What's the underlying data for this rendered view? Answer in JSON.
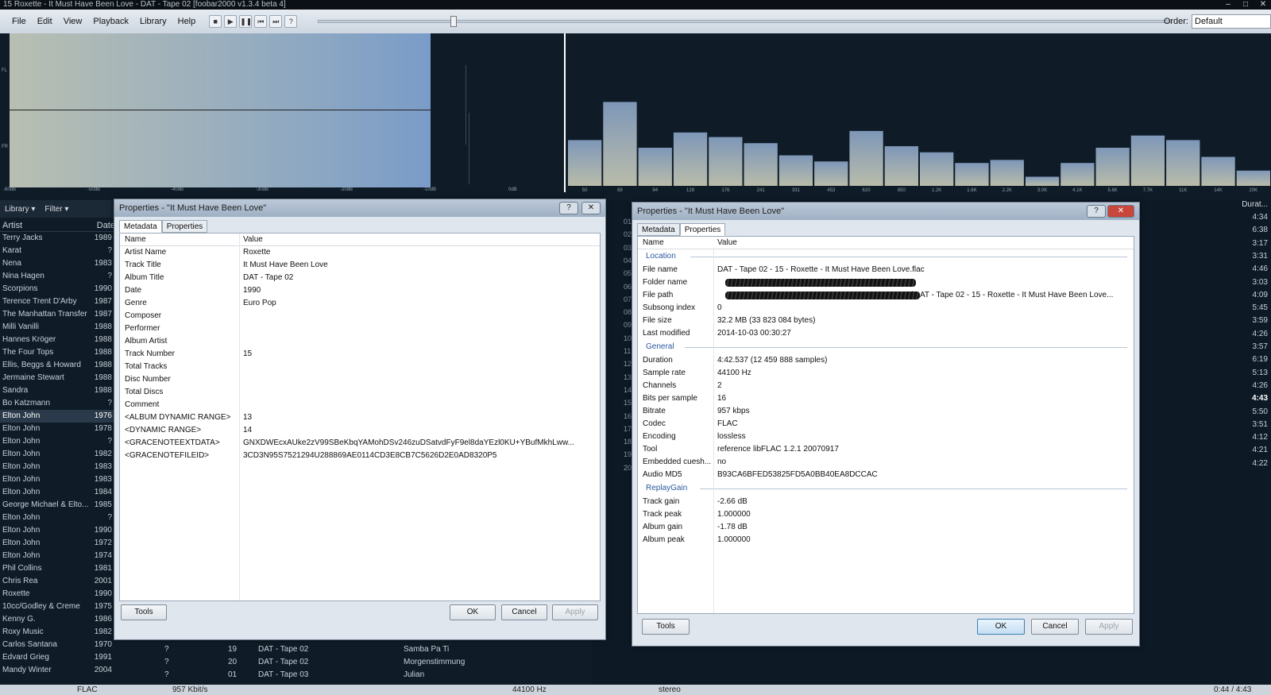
{
  "window": {
    "title": "15 Roxette - It Must Have Been Love - DAT - Tape 02   [foobar2000 v1.3.4 beta 4]"
  },
  "menu": [
    "File",
    "Edit",
    "View",
    "Playback",
    "Library",
    "Help"
  ],
  "order": {
    "label": "Order:",
    "value": "Default"
  },
  "visualizer": {
    "spectrogram_db_labels": [
      "-60dB",
      "-50dB",
      "-40dB",
      "-30dB",
      "-20dB",
      "-10dB",
      "0dB"
    ],
    "channel_labels": [
      "FL",
      "FR"
    ],
    "spectrum_freq_labels": [
      "50",
      "69",
      "94",
      "128",
      "176",
      "241",
      "331",
      "453",
      "620",
      "850",
      "1.2K",
      "1.6K",
      "2.2K",
      "3.0K",
      "4.1K",
      "5.6K",
      "7.7K",
      "11K",
      "14K",
      "20K"
    ],
    "spectrum_levels": [
      0.3,
      0.55,
      0.25,
      0.35,
      0.32,
      0.28,
      0.2,
      0.16,
      0.36,
      0.26,
      0.22,
      0.15,
      0.17,
      0.06,
      0.15,
      0.25,
      0.33,
      0.3,
      0.19,
      0.1
    ]
  },
  "library": {
    "buttons": [
      "Library",
      "Filter"
    ],
    "col_artist": "Artist",
    "col_date": "Date",
    "rows": [
      {
        "artist": "Terry Jacks",
        "date": "1989"
      },
      {
        "artist": "Karat",
        "date": "?"
      },
      {
        "artist": "Nena",
        "date": "1983"
      },
      {
        "artist": "Nina Hagen",
        "date": "?"
      },
      {
        "artist": "Scorpions",
        "date": "1990"
      },
      {
        "artist": "Terence Trent D'Arby",
        "date": "1987"
      },
      {
        "artist": "The Manhattan Transfer",
        "date": "1987"
      },
      {
        "artist": "Milli Vanilli",
        "date": "1988"
      },
      {
        "artist": "Hannes Kröger",
        "date": "1988"
      },
      {
        "artist": "The Four Tops",
        "date": "1988"
      },
      {
        "artist": "Ellis, Beggs & Howard",
        "date": "1988"
      },
      {
        "artist": "Jermaine Stewart",
        "date": "1988"
      },
      {
        "artist": "Sandra",
        "date": "1988"
      },
      {
        "artist": "Bo Katzmann",
        "date": "?"
      },
      {
        "artist": "Elton John",
        "date": "1976"
      },
      {
        "artist": "Elton John",
        "date": "1978"
      },
      {
        "artist": "Elton John",
        "date": "?"
      },
      {
        "artist": "Elton John",
        "date": "1982"
      },
      {
        "artist": "Elton John",
        "date": "1983"
      },
      {
        "artist": "Elton John",
        "date": "1983"
      },
      {
        "artist": "Elton John",
        "date": "1984"
      },
      {
        "artist": "George Michael & Elto...",
        "date": "1985"
      },
      {
        "artist": "Elton John",
        "date": "?"
      },
      {
        "artist": "Elton John",
        "date": "1990"
      },
      {
        "artist": "Elton John",
        "date": "1972"
      },
      {
        "artist": "Elton John",
        "date": "1974"
      },
      {
        "artist": "Phil Collins",
        "date": "1981"
      },
      {
        "artist": "Chris Rea",
        "date": "2001"
      },
      {
        "artist": "Roxette",
        "date": "1990"
      },
      {
        "artist": "10cc/Godley & Creme",
        "date": "1975"
      },
      {
        "artist": "Kenny G.",
        "date": "1986"
      },
      {
        "artist": "Roxy Music",
        "date": "1982"
      },
      {
        "artist": "Carlos Santana",
        "date": "1970"
      },
      {
        "artist": "Edvard Grieg",
        "date": "1991"
      },
      {
        "artist": "Mandy Winter",
        "date": "2004"
      }
    ]
  },
  "playlist_tail": [
    {
      "q": "?",
      "num": "19",
      "album": "DAT - Tape 02",
      "title": "Samba Pa Ti"
    },
    {
      "q": "?",
      "num": "20",
      "album": "DAT - Tape 02",
      "title": "Morgenstimmung"
    },
    {
      "q": "?",
      "num": "01",
      "album": "DAT - Tape 03",
      "title": "Julian"
    }
  ],
  "playlist_right": {
    "header_duration": "Durat...",
    "track_numbers": [
      "01",
      "02",
      "03",
      "04",
      "05",
      "06",
      "07",
      "08",
      "09",
      "10",
      "11",
      "12",
      "13",
      "14",
      "15",
      "16",
      "17",
      "18",
      "19",
      "20"
    ],
    "durations": [
      "4:34",
      "6:38",
      "3:17",
      "3:31",
      "4:46",
      "3:03",
      "4:09",
      "5:45",
      "3:59",
      "4:26",
      "3:57",
      "6:19",
      "5:13",
      "4:26",
      "4:43",
      "5:50",
      "3:51",
      "4:12",
      "4:21",
      "4:22"
    ]
  },
  "status": {
    "codec": "FLAC",
    "bitrate": "957 Kbit/s",
    "rate": "44100 Hz",
    "channels": "stereo",
    "time": "0:44 / 4:43"
  },
  "dialog_left": {
    "title": "Properties - \"It Must Have Been Love\"",
    "tabs": [
      "Metadata",
      "Properties"
    ],
    "col_name": "Name",
    "col_value": "Value",
    "rows": [
      {
        "name": "Artist Name",
        "value": "Roxette"
      },
      {
        "name": "Track Title",
        "value": "It Must Have Been Love"
      },
      {
        "name": "Album Title",
        "value": "DAT - Tape 02"
      },
      {
        "name": "Date",
        "value": "1990"
      },
      {
        "name": "Genre",
        "value": "Euro Pop"
      },
      {
        "name": "Composer",
        "value": ""
      },
      {
        "name": "Performer",
        "value": ""
      },
      {
        "name": "Album Artist",
        "value": ""
      },
      {
        "name": "Track Number",
        "value": "15"
      },
      {
        "name": "Total Tracks",
        "value": ""
      },
      {
        "name": "Disc Number",
        "value": ""
      },
      {
        "name": "Total Discs",
        "value": ""
      },
      {
        "name": "Comment",
        "value": ""
      },
      {
        "name": "<ALBUM DYNAMIC RANGE>",
        "value": "13"
      },
      {
        "name": "<DYNAMIC RANGE>",
        "value": "14"
      },
      {
        "name": "<GRACENOTEEXTDATA>",
        "value": "GNXDWEcxAUke2zV99SBeKbqYAMohDSv246zuDSatvdFyF9el8daYEzl0KU+YBufMkhLww..."
      },
      {
        "name": "<GRACENOTEFILEID>",
        "value": "3CD3N95S7521294U288869AE0114CD3E8CB7C5626D2E0AD8320P5"
      }
    ],
    "buttons": {
      "tools": "Tools",
      "ok": "OK",
      "cancel": "Cancel",
      "apply": "Apply"
    }
  },
  "dialog_right": {
    "title": "Properties - \"It Must Have Been Love\"",
    "tabs": [
      "Metadata",
      "Properties"
    ],
    "col_name": "Name",
    "col_value": "Value",
    "sections": [
      {
        "label": "Location",
        "rows": [
          {
            "name": "File name",
            "value": "DAT - Tape 02 - 15 - Roxette - It Must Have Been Love.flac"
          },
          {
            "name": "Folder name",
            "value": ""
          },
          {
            "name": "File path",
            "value": "\\DAT - Tape 02 - 15 - Roxette - It Must Have Been Love..."
          },
          {
            "name": "Subsong index",
            "value": "0"
          },
          {
            "name": "File size",
            "value": "32.2 MB (33 823 084 bytes)"
          },
          {
            "name": "Last modified",
            "value": "2014-10-03 00:30:27"
          }
        ]
      },
      {
        "label": "General",
        "rows": [
          {
            "name": "Duration",
            "value": "4:42.537 (12 459 888 samples)"
          },
          {
            "name": "Sample rate",
            "value": "44100 Hz"
          },
          {
            "name": "Channels",
            "value": "2"
          },
          {
            "name": "Bits per sample",
            "value": "16"
          },
          {
            "name": "Bitrate",
            "value": "957 kbps"
          },
          {
            "name": "Codec",
            "value": "FLAC"
          },
          {
            "name": "Encoding",
            "value": "lossless"
          },
          {
            "name": "Tool",
            "value": "reference libFLAC 1.2.1 20070917"
          },
          {
            "name": "Embedded cuesh...",
            "value": "no"
          },
          {
            "name": "Audio MD5",
            "value": "B93CA6BFED53825FD5A0BB40EA8DCCAC"
          }
        ]
      },
      {
        "label": "ReplayGain",
        "rows": [
          {
            "name": "Track gain",
            "value": "-2.66 dB"
          },
          {
            "name": "Track peak",
            "value": "1.000000"
          },
          {
            "name": "Album gain",
            "value": "-1.78 dB"
          },
          {
            "name": "Album peak",
            "value": "1.000000"
          }
        ]
      }
    ],
    "buttons": {
      "tools": "Tools",
      "ok": "OK",
      "cancel": "Cancel",
      "apply": "Apply"
    }
  }
}
